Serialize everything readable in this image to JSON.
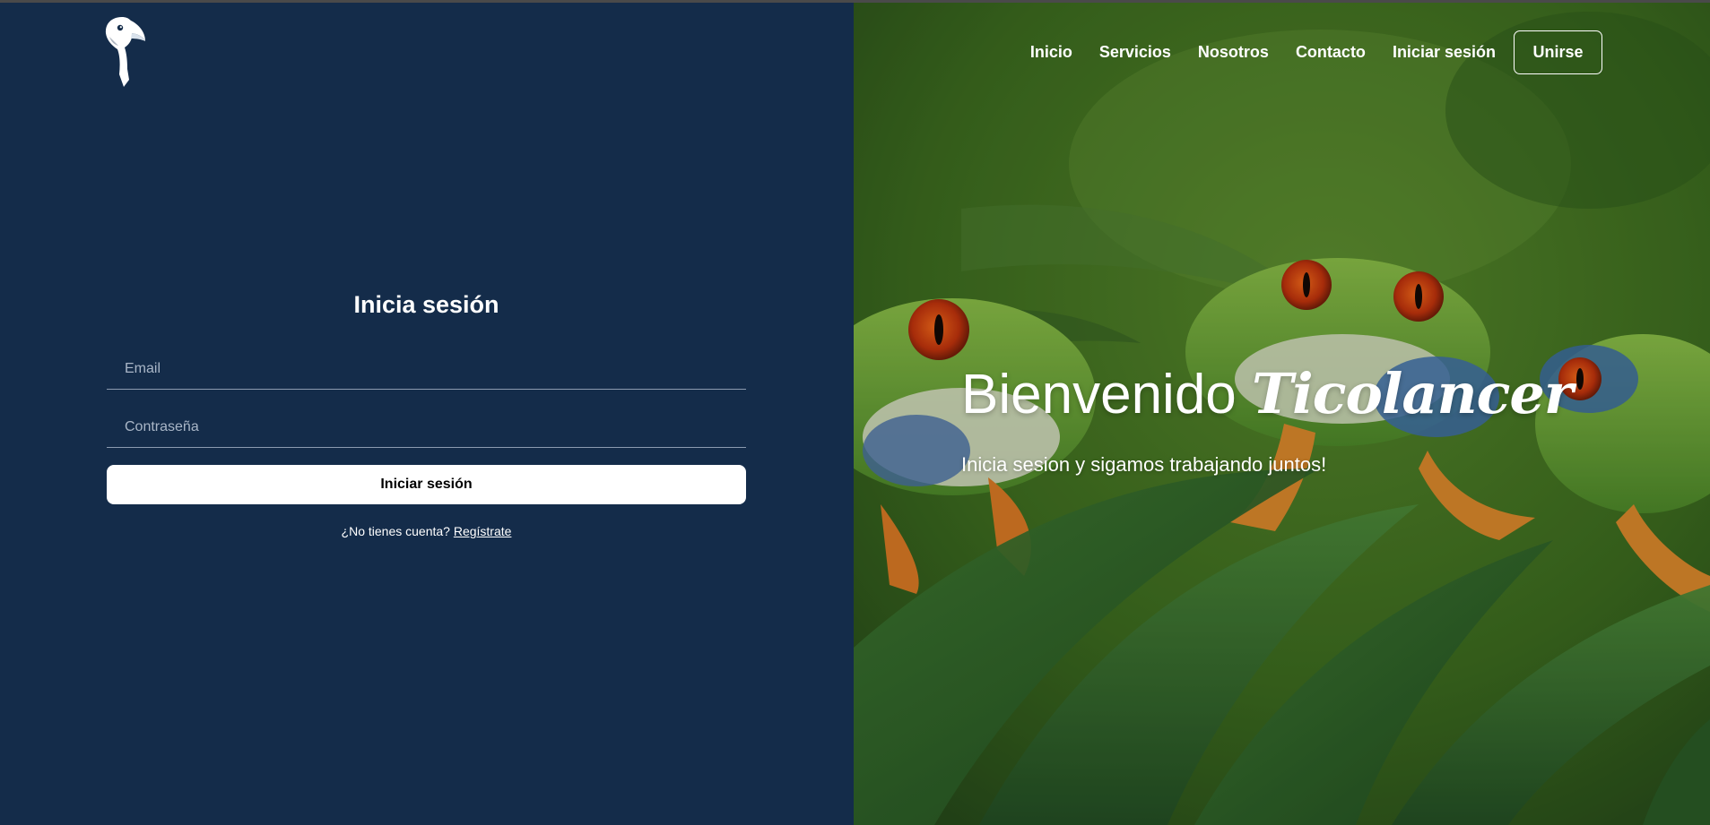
{
  "brand": {
    "logo_icon": "toucan-icon"
  },
  "login": {
    "title": "Inicia sesión",
    "email_placeholder": "Email",
    "password_placeholder": "Contraseña",
    "submit_label": "Iniciar sesión",
    "no_account_text": "¿No tienes cuenta? ",
    "register_link": "Regístrate"
  },
  "nav": {
    "items": [
      {
        "label": "Inicio"
      },
      {
        "label": "Servicios"
      },
      {
        "label": "Nosotros"
      },
      {
        "label": "Contacto"
      },
      {
        "label": "Iniciar sesión"
      }
    ],
    "join_label": "Unirse"
  },
  "hero": {
    "title_prefix": "Bienvenido ",
    "title_brand": "Ticolancer",
    "subtitle": "Inicia sesion y sigamos trabajando juntos!"
  },
  "colors": {
    "left_panel_bg": "#142c4a",
    "text": "#ffffff",
    "button_bg": "#ffffff"
  }
}
